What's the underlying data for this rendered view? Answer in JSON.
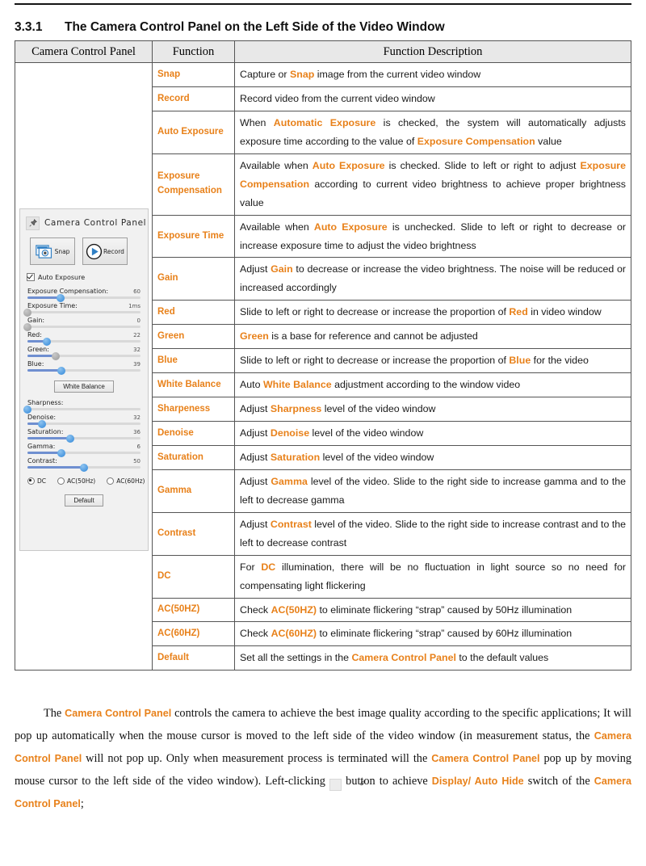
{
  "heading": {
    "number": "3.3.1",
    "title": "The Camera Control Panel on the Left Side of the Video Window"
  },
  "table": {
    "headers": [
      "Camera Control Panel",
      "Function",
      "Function Description"
    ],
    "rows": [
      {
        "function": "Snap",
        "description_parts": [
          {
            "t": "Capture or ",
            "hl": false
          },
          {
            "t": "Snap",
            "hl": true
          },
          {
            "t": " image from the current video window",
            "hl": false
          }
        ]
      },
      {
        "function": "Record",
        "description_parts": [
          {
            "t": "Record video from the current video window",
            "hl": false
          }
        ]
      },
      {
        "function": "Auto Exposure",
        "description_parts": [
          {
            "t": "When ",
            "hl": false
          },
          {
            "t": "Automatic Exposure",
            "hl": true
          },
          {
            "t": " is checked, the system will automatically adjusts exposure time according to the value of ",
            "hl": false
          },
          {
            "t": "Exposure Compensation",
            "hl": true
          },
          {
            "t": " value",
            "hl": false
          }
        ]
      },
      {
        "function": "Exposure Compensation",
        "description_parts": [
          {
            "t": "Available when ",
            "hl": false
          },
          {
            "t": "Auto Exposure",
            "hl": true
          },
          {
            "t": " is checked. Slide to left or right to adjust ",
            "hl": false
          },
          {
            "t": "Exposure Compensation",
            "hl": true
          },
          {
            "t": " according to current video brightness to achieve proper brightness value",
            "hl": false
          }
        ]
      },
      {
        "function": "Exposure Time",
        "description_parts": [
          {
            "t": "Available when ",
            "hl": false
          },
          {
            "t": "Auto Exposure",
            "hl": true
          },
          {
            "t": " is unchecked. Slide to left or right to decrease or increase exposure time to adjust the video brightness",
            "hl": false
          }
        ]
      },
      {
        "function": "Gain",
        "description_parts": [
          {
            "t": "Adjust ",
            "hl": false
          },
          {
            "t": "Gain",
            "hl": true
          },
          {
            "t": " to decrease or increase the video brightness. The noise will be reduced or increased accordingly",
            "hl": false
          }
        ]
      },
      {
        "function": "Red",
        "description_parts": [
          {
            "t": "Slide to left or right to decrease or increase the proportion of ",
            "hl": false
          },
          {
            "t": "Red",
            "hl": true
          },
          {
            "t": " in video window",
            "hl": false
          }
        ]
      },
      {
        "function": "Green",
        "description_parts": [
          {
            "t": "Green",
            "hl": true
          },
          {
            "t": " is a base for reference and cannot be adjusted",
            "hl": false
          }
        ]
      },
      {
        "function": "Blue",
        "description_parts": [
          {
            "t": "Slide to left or right to decrease or increase the proportion of ",
            "hl": false
          },
          {
            "t": "Blue",
            "hl": true
          },
          {
            "t": " for the video",
            "hl": false
          }
        ]
      },
      {
        "function": "White Balance",
        "description_parts": [
          {
            "t": "Auto ",
            "hl": false
          },
          {
            "t": "White Balance",
            "hl": true
          },
          {
            "t": " adjustment according to the window video",
            "hl": false
          }
        ]
      },
      {
        "function": "Sharpeness",
        "description_parts": [
          {
            "t": "Adjust ",
            "hl": false
          },
          {
            "t": "Sharpness",
            "hl": true
          },
          {
            "t": " level of the video window",
            "hl": false
          }
        ]
      },
      {
        "function": "Denoise",
        "description_parts": [
          {
            "t": "Adjust ",
            "hl": false
          },
          {
            "t": "Denoise",
            "hl": true
          },
          {
            "t": " level of the video window",
            "hl": false
          }
        ]
      },
      {
        "function": "Saturation",
        "description_parts": [
          {
            "t": "Adjust ",
            "hl": false
          },
          {
            "t": "Saturation",
            "hl": true
          },
          {
            "t": " level of the video window",
            "hl": false
          }
        ]
      },
      {
        "function": "Gamma",
        "description_parts": [
          {
            "t": "Adjust ",
            "hl": false
          },
          {
            "t": "Gamma",
            "hl": true
          },
          {
            "t": " level of the video. Slide to the right side to increase gamma and to the left to decrease gamma",
            "hl": false
          }
        ]
      },
      {
        "function": "Contrast",
        "description_parts": [
          {
            "t": "Adjust ",
            "hl": false
          },
          {
            "t": "Contrast",
            "hl": true
          },
          {
            "t": " level of the video. Slide to the right side to increase contrast and to the left to decrease contrast",
            "hl": false
          }
        ]
      },
      {
        "function": "DC",
        "description_parts": [
          {
            "t": "For ",
            "hl": false
          },
          {
            "t": "DC",
            "hl": true
          },
          {
            "t": " illumination, there will be no fluctuation in light source so no need for compensating light flickering",
            "hl": false
          }
        ]
      },
      {
        "function": "AC(50HZ)",
        "description_parts": [
          {
            "t": "Check ",
            "hl": false
          },
          {
            "t": "AC(50HZ)",
            "hl": true
          },
          {
            "t": " to eliminate flickering “strap” caused by 50Hz illumination",
            "hl": false
          }
        ]
      },
      {
        "function": "AC(60HZ)",
        "description_parts": [
          {
            "t": "Check ",
            "hl": false
          },
          {
            "t": "AC(60HZ)",
            "hl": true
          },
          {
            "t": " to eliminate flickering “strap” caused by 60Hz illumination",
            "hl": false
          }
        ]
      },
      {
        "function": "Default",
        "description_parts": [
          {
            "t": "Set all the settings in the ",
            "hl": false
          },
          {
            "t": "Camera Control Panel",
            "hl": true
          },
          {
            "t": " to the default values",
            "hl": false
          }
        ]
      }
    ]
  },
  "panel": {
    "title": "Camera Control Panel",
    "pin_icon": "pushpin-icon",
    "snap_label": "Snap",
    "record_label": "Record",
    "auto_exposure_label": "Auto Exposure",
    "auto_exposure_checked": true,
    "sliders": [
      {
        "name": "Exposure Compensation:",
        "value": "60",
        "pct": 29,
        "knob": "blue"
      },
      {
        "name": "Exposure Time:",
        "value": "1ms",
        "pct": 0,
        "knob": "gray"
      },
      {
        "name": "Gain:",
        "value": "0",
        "pct": 0,
        "knob": "gray"
      },
      {
        "name": "Red:",
        "value": "22",
        "pct": 17,
        "knob": "blue"
      },
      {
        "name": "Green:",
        "value": "32",
        "pct": 25,
        "knob": "gray"
      },
      {
        "name": "Blue:",
        "value": "39",
        "pct": 30,
        "knob": "blue"
      }
    ],
    "white_balance_label": "White Balance",
    "sliders2": [
      {
        "name": "Sharpness:",
        "value": "",
        "pct": 0,
        "knob": "blue"
      },
      {
        "name": "Denoise:",
        "value": "32",
        "pct": 13,
        "knob": "blue"
      },
      {
        "name": "Saturation:",
        "value": "36",
        "pct": 38,
        "knob": "blue"
      },
      {
        "name": "Gamma:",
        "value": "6",
        "pct": 30,
        "knob": "blue"
      },
      {
        "name": "Contrast:",
        "value": "50",
        "pct": 50,
        "knob": "blue"
      }
    ],
    "radios": [
      {
        "label": "DC",
        "selected": true
      },
      {
        "label": "AC(50Hz)",
        "selected": false
      },
      {
        "label": "AC(60Hz)",
        "selected": false
      }
    ],
    "default_label": "Default"
  },
  "paragraph_parts": [
    {
      "t": "The ",
      "hl": false
    },
    {
      "t": "Camera Control Panel",
      "hl": true
    },
    {
      "t": " controls the camera to achieve the best image quality according to the specific applications; It will pop up automatically when the mouse cursor is moved to the left side of the video window (in measurement status, the ",
      "hl": false
    },
    {
      "t": "Camera Control Panel",
      "hl": true
    },
    {
      "t": " will not pop up. Only when measurement process is terminated will the ",
      "hl": false
    },
    {
      "t": "Camera Control Panel",
      "hl": true
    },
    {
      "t": " pop up by moving mouse cursor to the left side of the video window). Left-clicking ",
      "hl": false
    },
    {
      "t": "__PIN__",
      "hl": false
    },
    {
      "t": " button to achieve ",
      "hl": false
    },
    {
      "t": "Display/ Auto Hide",
      "hl": true
    },
    {
      "t": " switch of the ",
      "hl": false
    },
    {
      "t": "Camera Control Panel",
      "hl": true
    },
    {
      "t": ";",
      "hl": false
    }
  ],
  "colors": {
    "accent_orange": "#E8811A",
    "header_bg": "#E8E8E8",
    "panel_bg": "#F1F1F1",
    "slider_blue": "#2F86D8"
  }
}
